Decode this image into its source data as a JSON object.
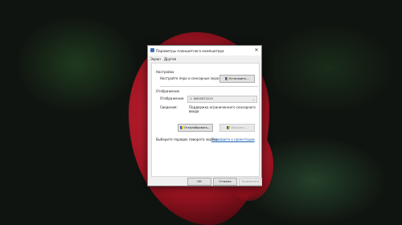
{
  "window": {
    "title": "Параметры планшетного компьютера",
    "close_glyph": "✕"
  },
  "tabs": [
    {
      "label": "Экран"
    },
    {
      "label": "Другие"
    }
  ],
  "settings_section": {
    "heading": "Настройка",
    "description": "Настройте перо и сенсорные экраны.",
    "button_label": "Установить..."
  },
  "display_section": {
    "heading": "Отображение",
    "display_label": "Отображение:",
    "display_value": "1. W6956T2019",
    "details_label": "Сведения:",
    "details_value_line1": "Поддержка ограниченного сенсорного",
    "details_value_line2": "ввода",
    "calibrate_label": "Откалибровать...",
    "reset_label": "Сбросить..."
  },
  "rotation": {
    "text": "Выберите порядок поворота экрана.",
    "link": "Перейдите к ориентации"
  },
  "footer": {
    "ok_label": "ОК",
    "cancel_label": "Отмена",
    "apply_label": "Применить"
  },
  "icons": {
    "app": "tablet-settings-icon",
    "shield": "uac-shield-icon"
  }
}
